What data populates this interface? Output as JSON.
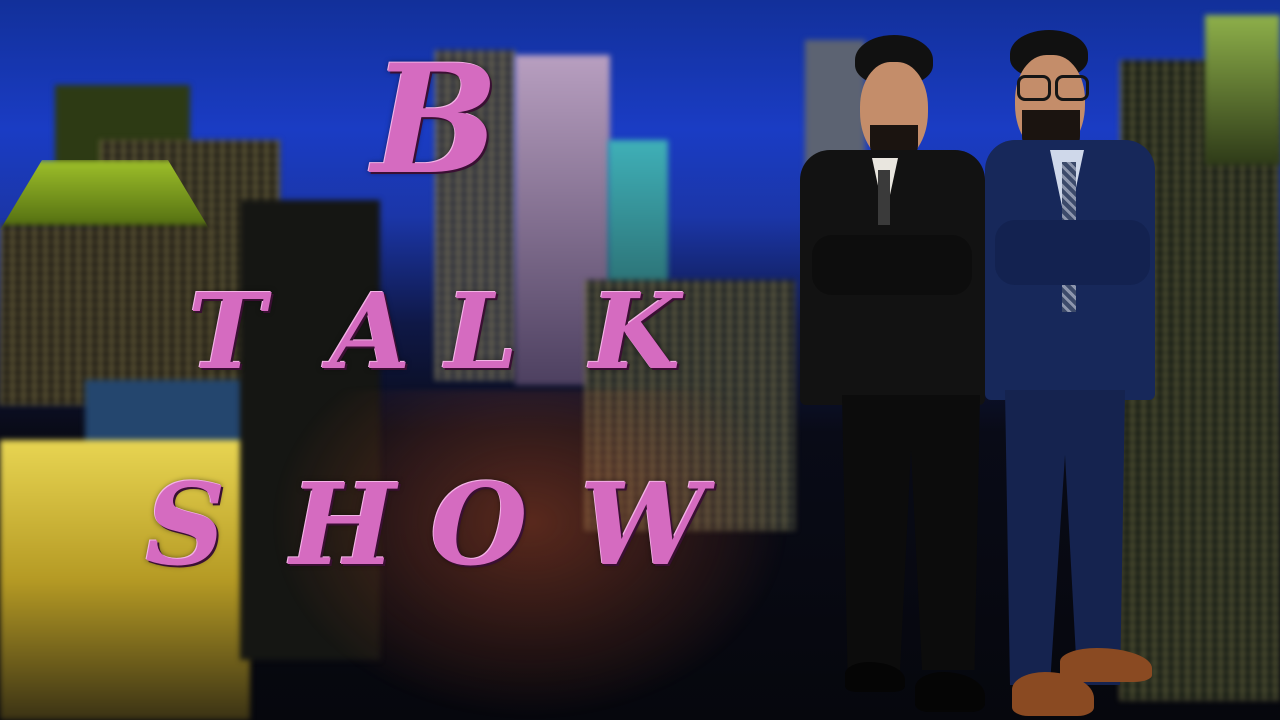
{
  "title": {
    "line1": "B",
    "line2": [
      "T",
      "A",
      "L",
      "K"
    ],
    "line3": [
      "S",
      "H",
      "O",
      "W"
    ]
  },
  "colors": {
    "title_pink": "#d56bc0",
    "sky": "#1a3cc4",
    "night": "#06070d",
    "black_suit": "#121212",
    "navy_suit": "#17285a"
  },
  "scene": {
    "background": "blurred-night-city-skyline",
    "people": [
      "man-in-black-suit",
      "man-in-navy-suit-with-glasses"
    ]
  }
}
